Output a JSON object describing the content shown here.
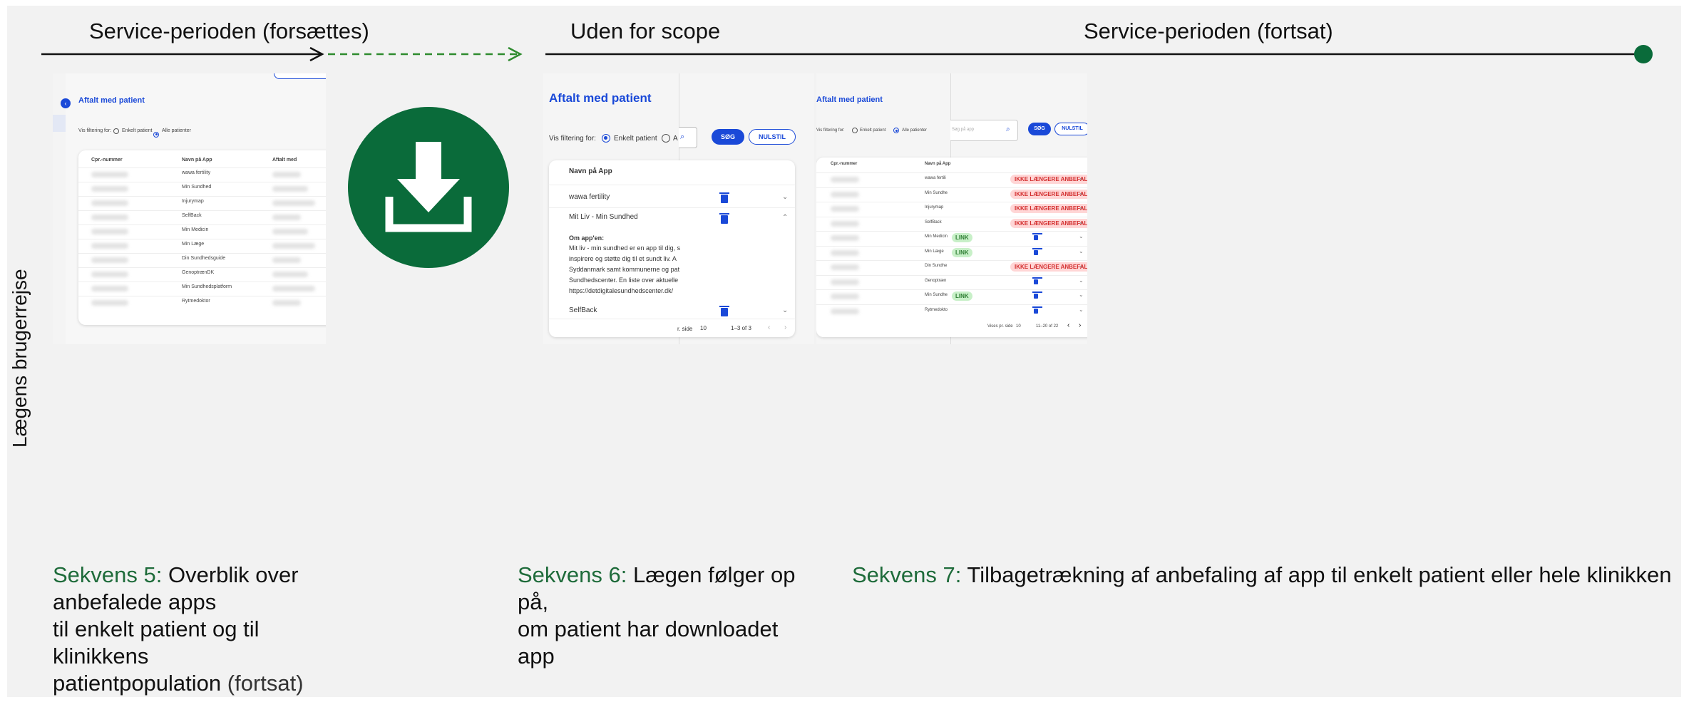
{
  "phases": {
    "left": "Service-perioden (forsættes)",
    "middle": "Uden for scope",
    "right": "Service-perioden (fortsat)"
  },
  "side_label": "Lægens brugerrejse",
  "colors": {
    "accent_green": "#0a6b3a",
    "caption_green": "#1e6b3a",
    "ui_blue": "#1a49d8",
    "dashed_arrow": "#2e8b2e"
  },
  "captions": {
    "seq5": {
      "label": "Sekvens 5:",
      "line1": " Overblik over anbefalede apps",
      "line2": "til enkelt patient og til klinikkens",
      "line3": "patientpopulation",
      "suffix": " (fortsat)"
    },
    "seq6": {
      "label": "Sekvens 6:",
      "line1": " Lægen følger op på,",
      "line2": "om patient har downloadet app"
    },
    "seq7": {
      "label": "Sekvens 7:",
      "line1": " Tilbagetrækning af anbefaling af app til enkelt patient eller hele klinikken"
    }
  },
  "download_icon": "download-icon",
  "screen5": {
    "title": "Aftalt med patient",
    "filter_label": "Vis filtering for:",
    "option1": "Enkelt patient",
    "option2": "Alle patienter",
    "columns": [
      "Cpr.-nummer",
      "Navn på App",
      "Aftalt med"
    ],
    "apps": [
      "wawa fertility",
      "Min Sundhed",
      "Injurymap",
      "SelfBack",
      "Min Medicin",
      "Min Læge",
      "Din Sundhedsguide",
      "GenoptrænDK",
      "Min Sundhedsplatform",
      "Rytmedoktor"
    ]
  },
  "screen7a": {
    "title": "Aftalt med patient",
    "filter_label": "Vis filtering for:",
    "option1": "Enkelt patient",
    "option2": "A",
    "search_button": "SØG",
    "reset_button": "NULSTIL",
    "column": "Navn på App",
    "rows": [
      "wawa fertility",
      "Mit Liv - Min Sundhed",
      "SelfBack"
    ],
    "detail_heading": "Om app'en:",
    "detail_lines": [
      "Mit liv - min sundhed er en app til dig, s",
      "inspirere og støtte dig til et sundt liv. A",
      "Syddanmark samt kommunerne og pat",
      "Sundhedscenter. En liste over aktuelle",
      "https://detdigitalesundhedscenter.dk/"
    ],
    "per_page_label": "r. side",
    "per_page_value": "10",
    "range": "1–3 of 3"
  },
  "screen7b": {
    "title": "Aftalt med patient",
    "filter_label": "Vis filtering for:",
    "option1": "Enkelt patient",
    "option2": "Alle patienter",
    "search_placeholder": "Søg på app",
    "search_button": "SØG",
    "reset_button": "NULSTIL",
    "columns": [
      "Cpr.-nummer",
      "Navn på App"
    ],
    "apps": [
      "wawa fertili",
      "Min Sundhe",
      "Injurymap",
      "SelfBack",
      "Min Medicin",
      "Min Læge",
      "Din Sundhe",
      "Genoptræn",
      "Min Sundhe",
      "Rytmedokto"
    ],
    "status_red": "IKKE LÆNGERE ANBEFALET",
    "status_green": "LINK",
    "row_status": [
      "red",
      "red",
      "red",
      "red",
      "trash",
      "trash",
      "red",
      "trash",
      "trash",
      "trash"
    ],
    "row_green": [
      false,
      false,
      false,
      false,
      true,
      true,
      false,
      false,
      true,
      false
    ],
    "per_page_label": "Vises pr. side",
    "per_page_value": "10",
    "range": "11–20 of 22"
  }
}
